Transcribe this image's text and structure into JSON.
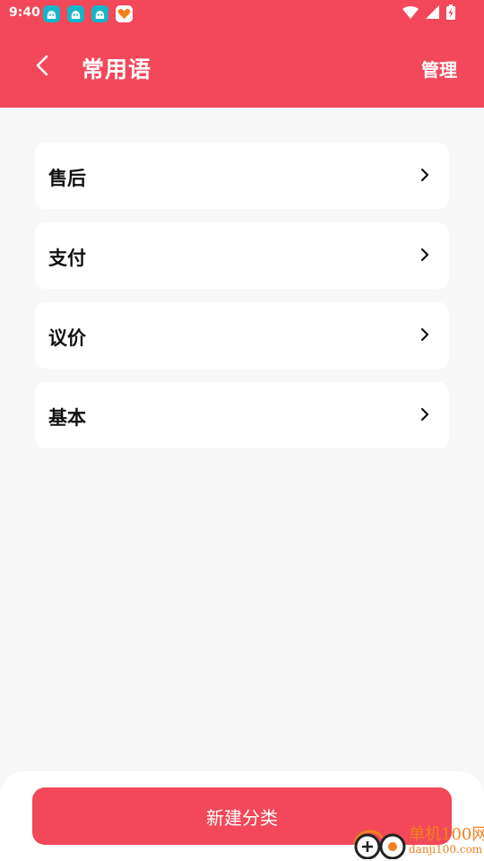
{
  "status_bar": {
    "time": "9:40",
    "notification_icons": [
      "app-notification-icon",
      "app-notification-icon",
      "app-notification-icon",
      "heart-app-icon"
    ],
    "system_icons": [
      "wifi-icon",
      "signal-icon",
      "battery-charging-icon"
    ]
  },
  "header": {
    "title": "常用语",
    "manage_label": "管理",
    "back_icon": "chevron-left-icon"
  },
  "categories": [
    {
      "label": "售后"
    },
    {
      "label": "支付"
    },
    {
      "label": "议价"
    },
    {
      "label": "基本"
    }
  ],
  "footer": {
    "new_category_label": "新建分类"
  },
  "watermark": {
    "name": "单机100网",
    "url": "danji100.com"
  },
  "colors": {
    "accent": "#f2485a",
    "background": "#f7f7f7",
    "card": "#ffffff",
    "watermark": "#f0821e"
  }
}
